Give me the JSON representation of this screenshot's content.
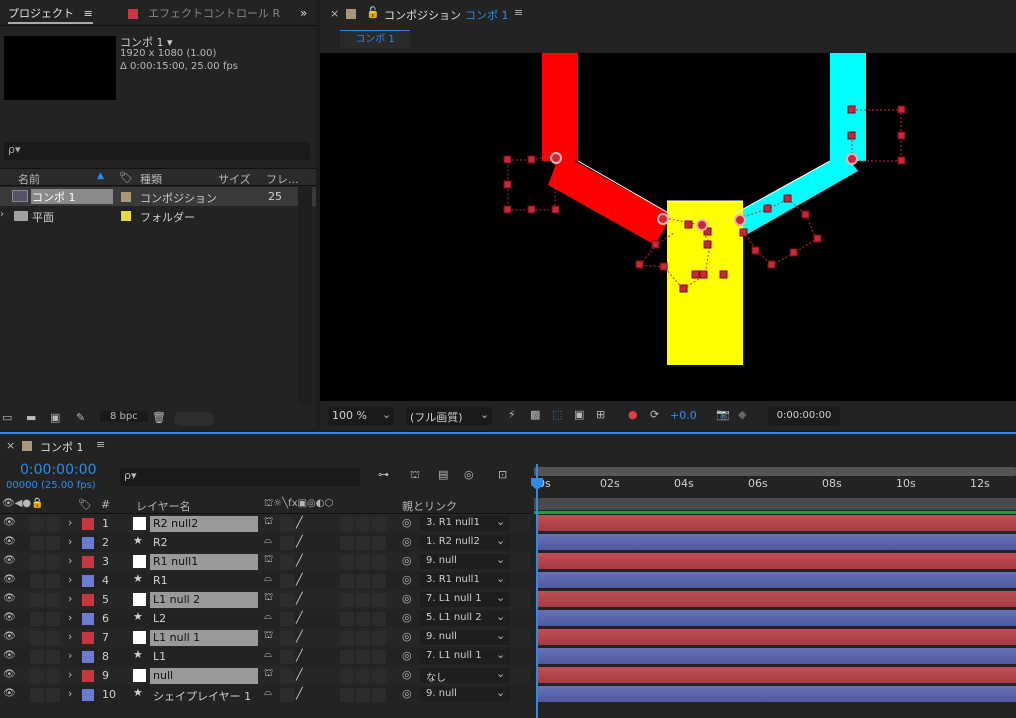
{
  "project_panel": {
    "tab_project": "プロジェクト",
    "tab_effect": "エフェクトコントロール R",
    "comp_name": "コンポ 1 ▾",
    "comp_res": "1920 x 1080 (1.00)",
    "comp_duration": "Δ 0:00:15:00, 25.00 fps",
    "search_placeholder": "ρ▾",
    "col_name": "名前",
    "col_type": "種類",
    "col_size": "サイズ",
    "col_frame": "フレ...",
    "items": [
      {
        "name": "コンポ 1",
        "type": "コンポジション",
        "frame": "25",
        "color": "#a89878"
      },
      {
        "name": "平面",
        "type": "フォルダー",
        "frame": "",
        "color": "#e8d840"
      }
    ],
    "bpc": "8 bpc"
  },
  "comp_panel": {
    "title_prefix": "コンポジション",
    "title_name": "コンポ 1",
    "subtab": "コンポ 1",
    "zoom": "100 %",
    "quality": "(フル画質)",
    "exposure": "+0.0",
    "timecode": "0:00:00:00"
  },
  "timeline": {
    "tab": "コンポ 1",
    "timecode": "0:00:00:00",
    "fps": "00000 (25.00 fps)",
    "col_num": "#",
    "col_layer": "レイヤー名",
    "col_parent": "親とリンク",
    "ruler": [
      "0s",
      "02s",
      "04s",
      "06s",
      "08s",
      "10s",
      "12s"
    ],
    "layers": [
      {
        "num": "1",
        "name": "R2 null2",
        "parent": "3. R1 null1",
        "color": "#c8383e",
        "kind": "null",
        "bar": "red"
      },
      {
        "num": "2",
        "name": "R2",
        "parent": "1. R2 null2",
        "color": "#6c7cd0",
        "kind": "shape",
        "bar": "blue"
      },
      {
        "num": "3",
        "name": "R1 null1",
        "parent": "9. null",
        "color": "#c8383e",
        "kind": "null",
        "bar": "red"
      },
      {
        "num": "4",
        "name": "R1",
        "parent": "3. R1 null1",
        "color": "#6c7cd0",
        "kind": "shape",
        "bar": "blue"
      },
      {
        "num": "5",
        "name": "L1 null 2",
        "parent": "7. L1 null 1",
        "color": "#c8383e",
        "kind": "null",
        "bar": "red"
      },
      {
        "num": "6",
        "name": "L2",
        "parent": "5. L1 null 2",
        "color": "#6c7cd0",
        "kind": "shape",
        "bar": "blue"
      },
      {
        "num": "7",
        "name": "L1 null 1",
        "parent": "9. null",
        "color": "#c8383e",
        "kind": "null",
        "bar": "red"
      },
      {
        "num": "8",
        "name": "L1",
        "parent": "7. L1 null 1",
        "color": "#6c7cd0",
        "kind": "shape",
        "bar": "blue"
      },
      {
        "num": "9",
        "name": "null",
        "parent": "なし",
        "color": "#c8383e",
        "kind": "null",
        "bar": "red"
      },
      {
        "num": "10",
        "name": "シェイプレイヤー 1",
        "parent": "9. null",
        "color": "#6c7cd0",
        "kind": "shape",
        "bar": "blue"
      }
    ]
  },
  "colors": {
    "accent_blue": "#2d8ceb",
    "red_shape": "#ff0000",
    "cyan_shape": "#00ffff",
    "yellow_shape": "#ffff00"
  }
}
